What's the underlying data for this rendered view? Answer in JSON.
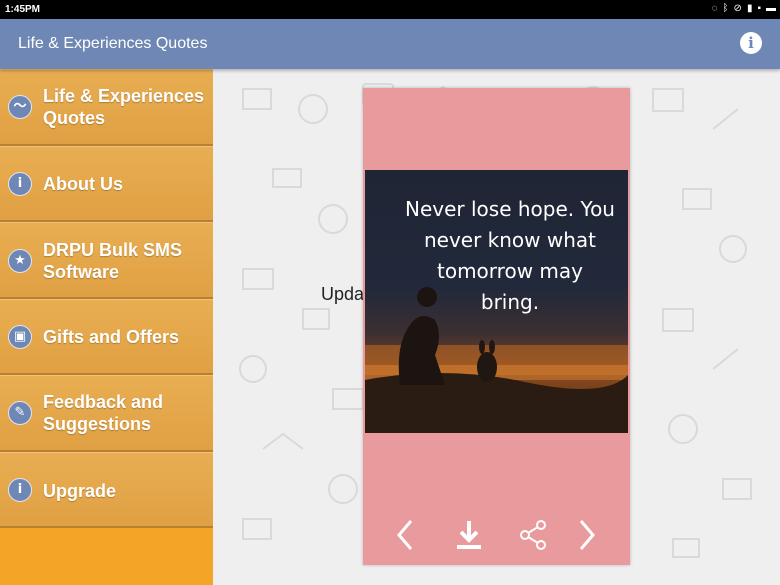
{
  "status_bar": {
    "time": "1:45PM",
    "icons": [
      "sync-icon",
      "bluetooth-icon",
      "wifi-off-icon",
      "signal-icon",
      "lock-icon",
      "battery-icon"
    ]
  },
  "app_bar": {
    "title": "Life & Experiences Quotes",
    "info_icon": "info-icon"
  },
  "drawer": {
    "items": [
      {
        "label": "Life & Experiences Quotes",
        "icon": "pulse-icon"
      },
      {
        "label": "About Us",
        "icon": "info-icon"
      },
      {
        "label": "DRPU Bulk SMS Software",
        "icon": "star-icon"
      },
      {
        "label": "Gifts and Offers",
        "icon": "gift-icon"
      },
      {
        "label": "Feedback and Suggestions",
        "icon": "feedback-icon"
      },
      {
        "label": "Upgrade",
        "icon": "info-icon"
      }
    ]
  },
  "main": {
    "background_text": "Upda",
    "quote_card": {
      "quote": "Never lose hope. You never know what tomorrow may bring.",
      "toolbar": [
        "previous-icon",
        "download-icon",
        "share-icon",
        "next-icon"
      ]
    }
  },
  "colors": {
    "app_bar": "#6f87b4",
    "drawer": "#e9ae52",
    "card": "#e99a9d"
  }
}
